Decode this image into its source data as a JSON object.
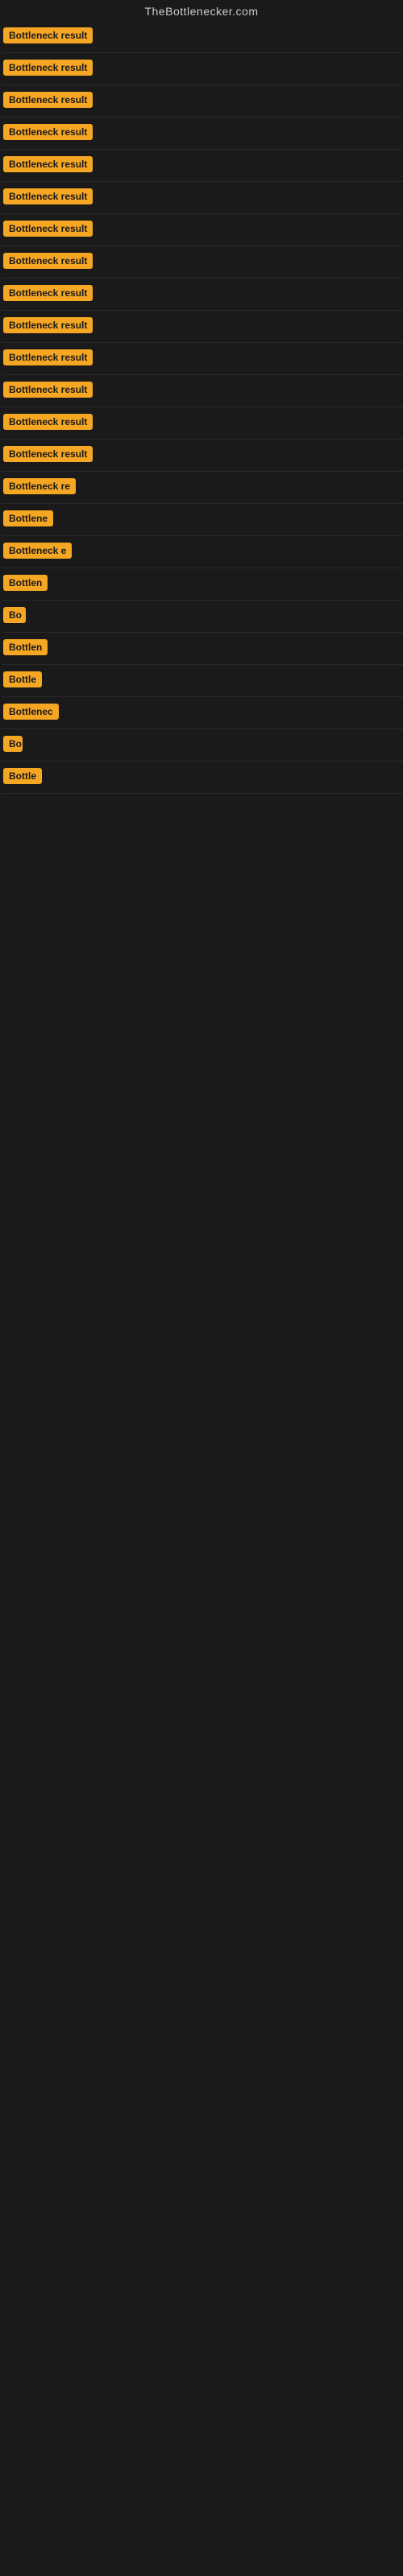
{
  "site": {
    "title": "TheBottlenecker.com"
  },
  "rows": [
    {
      "id": 1,
      "label": "Bottleneck result",
      "width": 130
    },
    {
      "id": 2,
      "label": "Bottleneck result",
      "width": 130
    },
    {
      "id": 3,
      "label": "Bottleneck result",
      "width": 130
    },
    {
      "id": 4,
      "label": "Bottleneck result",
      "width": 130
    },
    {
      "id": 5,
      "label": "Bottleneck result",
      "width": 130
    },
    {
      "id": 6,
      "label": "Bottleneck result",
      "width": 130
    },
    {
      "id": 7,
      "label": "Bottleneck result",
      "width": 130
    },
    {
      "id": 8,
      "label": "Bottleneck result",
      "width": 130
    },
    {
      "id": 9,
      "label": "Bottleneck result",
      "width": 130
    },
    {
      "id": 10,
      "label": "Bottleneck result",
      "width": 130
    },
    {
      "id": 11,
      "label": "Bottleneck result",
      "width": 130
    },
    {
      "id": 12,
      "label": "Bottleneck result",
      "width": 130
    },
    {
      "id": 13,
      "label": "Bottleneck result",
      "width": 130
    },
    {
      "id": 14,
      "label": "Bottleneck result",
      "width": 130
    },
    {
      "id": 15,
      "label": "Bottleneck re",
      "width": 102
    },
    {
      "id": 16,
      "label": "Bottlene",
      "width": 72
    },
    {
      "id": 17,
      "label": "Bottleneck e",
      "width": 86
    },
    {
      "id": 18,
      "label": "Bottlen",
      "width": 62
    },
    {
      "id": 19,
      "label": "Bo",
      "width": 28
    },
    {
      "id": 20,
      "label": "Bottlen",
      "width": 62
    },
    {
      "id": 21,
      "label": "Bottle",
      "width": 52
    },
    {
      "id": 22,
      "label": "Bottlenec",
      "width": 78
    },
    {
      "id": 23,
      "label": "Bo",
      "width": 24
    },
    {
      "id": 24,
      "label": "Bottle",
      "width": 52
    }
  ],
  "colors": {
    "badge_bg": "#f5a623",
    "body_bg": "#1a1a1a",
    "title_color": "#cccccc"
  }
}
